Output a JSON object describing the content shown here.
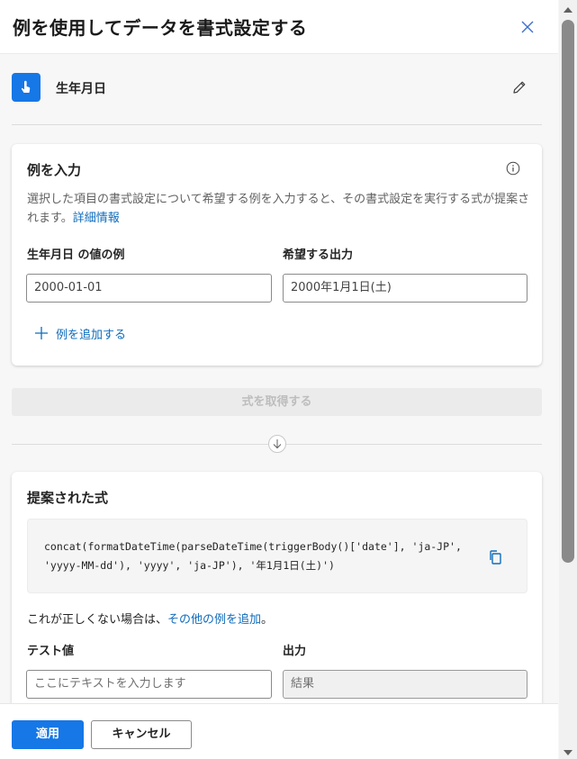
{
  "header": {
    "title": "例を使用してデータを書式設定する"
  },
  "trigger": {
    "label": "生年月日",
    "icon": "tap-hand-icon",
    "icon_color": "#1677e6"
  },
  "examples_card": {
    "title": "例を入力",
    "description": "選択した項目の書式設定について希望する例を入力すると、その書式設定を実行する式が提案されます。",
    "learn_more": "詳細情報",
    "value_label": "生年月日 の値の例",
    "output_label": "希望する出力",
    "value_example": "2000-01-01",
    "output_example": "2000年1月1日(土)",
    "add_example": "例を追加する"
  },
  "get_formula_button": "式を取得する",
  "suggested_card": {
    "title": "提案された式",
    "formula_line1": "concat(formatDateTime(parseDateTime(triggerBody()['date'], 'ja-JP',",
    "formula_line2": "'yyyy-MM-dd'), 'yyyy', 'ja-JP'), '年1月1日(土)')",
    "not_right_prefix": "これが正しくない場合は、",
    "not_right_link": "その他の例を追加",
    "not_right_suffix": "。",
    "test_value_label": "テスト値",
    "output_label": "出力",
    "test_placeholder": "ここにテキストを入力します",
    "result_placeholder": "結果"
  },
  "footer": {
    "apply": "適用",
    "cancel": "キャンセル"
  },
  "colors": {
    "accent": "#1677e6",
    "link": "#0f6cbd"
  }
}
